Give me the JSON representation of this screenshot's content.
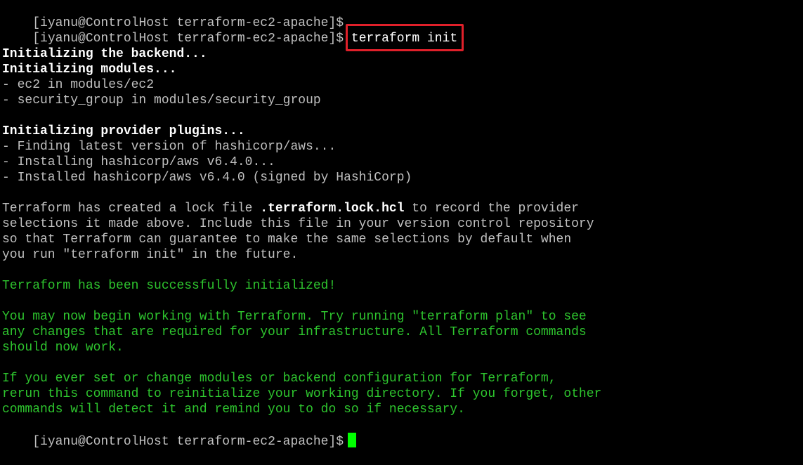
{
  "prompt": "[iyanu@ControlHost terraform-ec2-apache]$",
  "command": "terraform init",
  "backend_line": "Initializing the backend...",
  "modules": {
    "header": "Initializing modules...",
    "items": [
      "- ec2 in modules/ec2",
      "- security_group in modules/security_group"
    ]
  },
  "providers": {
    "header": "Initializing provider plugins...",
    "items": [
      "- Finding latest version of hashicorp/aws...",
      "- Installing hashicorp/aws v6.4.0...",
      "- Installed hashicorp/aws v6.4.0 (signed by HashiCorp)"
    ]
  },
  "lock_file": {
    "line1_before": "Terraform has created a lock file ",
    "filename": ".terraform.lock.hcl",
    "line1_after": " to record the provider",
    "line2": "selections it made above. Include this file in your version control repository",
    "line3": "so that Terraform can guarantee to make the same selections by default when",
    "line4": "you run \"terraform init\" in the future."
  },
  "success": "Terraform has been successfully initialized!",
  "next_steps": [
    "You may now begin working with Terraform. Try running \"terraform plan\" to see",
    "any changes that are required for your infrastructure. All Terraform commands",
    "should now work."
  ],
  "reinit": [
    "If you ever set or change modules or backend configuration for Terraform,",
    "rerun this command to reinitialize your working directory. If you forget, other",
    "commands will detect it and remind you to do so if necessary."
  ],
  "colors": {
    "background": "#000000",
    "prompt_text": "#c0c0c0",
    "bright_text": "#ffffff",
    "success_green": "#2ec52e",
    "cursor": "#00ff00",
    "highlight_box": "#e0202a"
  }
}
